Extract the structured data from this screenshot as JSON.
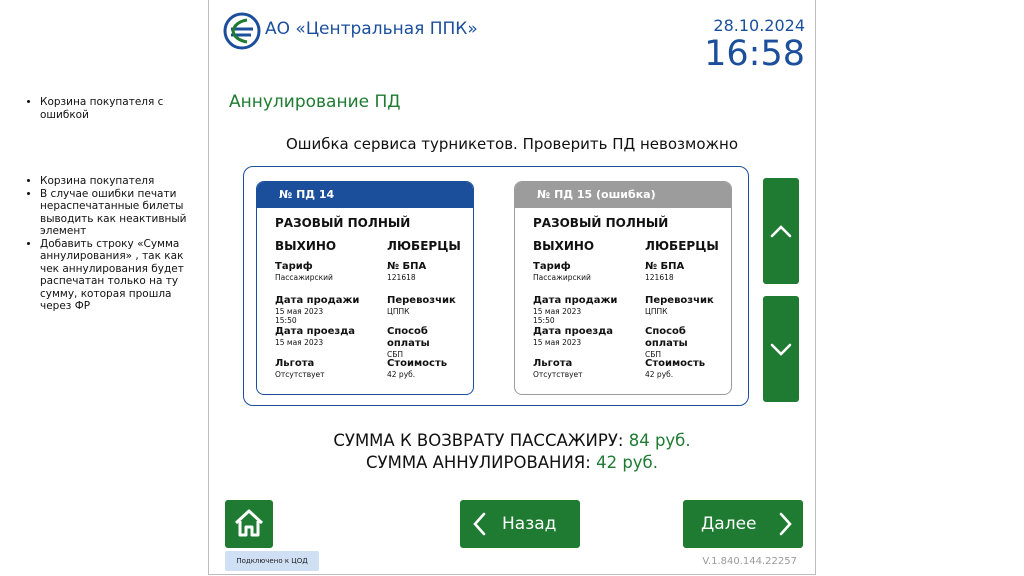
{
  "notes": {
    "group1": [
      "Корзина покупателя с ошибкой"
    ],
    "group2": [
      "Корзина покупателя",
      "В случае ошибки печати нераспечатанные билеты выводить как неактивный элемент",
      "Добавить строку «Сумма аннулирования» , так как чек аннулирования будет распечатан только на ту сумму, которая прошла через ФР"
    ]
  },
  "header": {
    "company": "АО «Центральная ППК»",
    "date": "28.10.2024",
    "time": "16:58",
    "logo_icon": "ppk-logo-icon"
  },
  "page_title": "Аннулирование ПД",
  "error_message": "Ошибка сервиса турникетов. Проверить ПД невозможно",
  "tickets": [
    {
      "header": "№ ПД 14",
      "type": "РАЗОВЫЙ ПОЛНЫЙ",
      "from": "ВЫХИНО",
      "to": "ЛЮБЕРЦЫ",
      "tariff_label": "Тариф",
      "tariff": "Пассажирский",
      "bpa_label": "№ БПА",
      "bpa": "121618",
      "sale_date_label": "Дата продажи",
      "sale_date": "15 мая 2023",
      "sale_time": "15:50",
      "carrier_label": "Перевозчик",
      "carrier": "ЦППК",
      "travel_date_label": "Дата проезда",
      "travel_date": "15 мая 2023",
      "payment_label": "Способ оплаты",
      "payment": "СБП",
      "benefit_label": "Льгота",
      "benefit": "Отсутствует",
      "cost_label": "Стоимость",
      "cost": "42 руб.",
      "header_color": "#1b4f9c"
    },
    {
      "header": "№ ПД 15 (ошибка)",
      "type": "РАЗОВЫЙ ПОЛНЫЙ",
      "from": "ВЫХИНО",
      "to": "ЛЮБЕРЦЫ",
      "tariff_label": "Тариф",
      "tariff": "Пассажирский",
      "bpa_label": "№ БПА",
      "bpa": "121618",
      "sale_date_label": "Дата продажи",
      "sale_date": "15 мая 2023",
      "sale_time": "15:50",
      "carrier_label": "Перевозчик",
      "carrier": "ЦППК",
      "travel_date_label": "Дата проезда",
      "travel_date": "15 мая 2023",
      "payment_label": "Способ оплаты",
      "payment": "СБП",
      "benefit_label": "Льгота",
      "benefit": "Отсутствует",
      "cost_label": "Стоимость",
      "cost": "42  руб.",
      "header_color": "#9c9c9c"
    }
  ],
  "scroll": {
    "up_icon": "chevron-up-icon",
    "down_icon": "chevron-down-icon"
  },
  "summary": {
    "refund_label": "СУММА К ВОЗВРАТУ ПАССАЖИРУ:",
    "refund_value": "84 руб.",
    "cancel_label": "СУММА АННУЛИРОВАНИЯ:",
    "cancel_value": "42 руб."
  },
  "footer": {
    "home_icon": "home-icon",
    "back_label": "Назад",
    "next_label": "Далее",
    "status": "Подключено к ЦОД",
    "version": "V.1.840.144.22257"
  },
  "colors": {
    "accent_blue": "#1b4f9c",
    "accent_green": "#1e7b31",
    "disabled_gray": "#9c9c9c"
  }
}
